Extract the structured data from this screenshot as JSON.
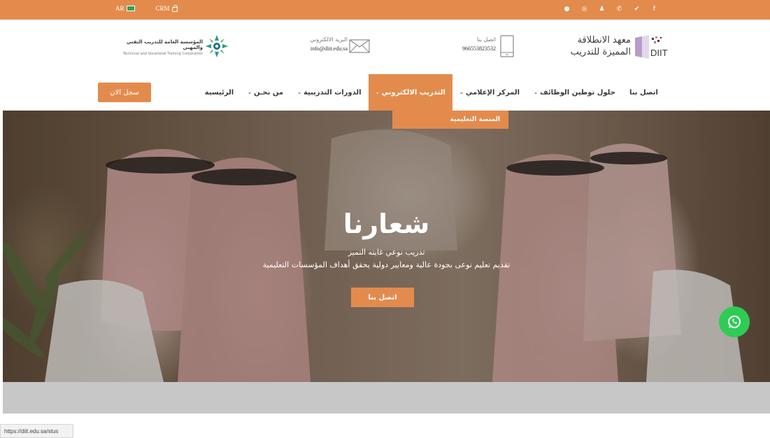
{
  "topbar": {
    "lang_label": "AR",
    "crm_label": "CRM",
    "social": [
      {
        "icon": "circle-icon",
        "glyph": "●"
      },
      {
        "icon": "instagram-icon",
        "glyph": "◎"
      },
      {
        "icon": "snapchat-icon",
        "glyph": "♟"
      },
      {
        "icon": "whatsapp-icon",
        "glyph": "✆"
      },
      {
        "icon": "twitter-icon",
        "glyph": "✔"
      },
      {
        "icon": "facebook-icon",
        "glyph": "f"
      }
    ]
  },
  "header": {
    "tvtc_ar": "المؤسسة العامة للتدريب التقني والمهني",
    "tvtc_en": "Technical and Vocational Training Corporation",
    "email_label": "البريد الالكتروني",
    "email_value": "info@diit.edu.sa",
    "phone_label": "اتصل بنا",
    "phone_value": "966553823532",
    "brand_line1": "معهد الانطلاقة",
    "brand_line2": "المميزة للتدريب",
    "brand_logo_text": "DIIT"
  },
  "nav": {
    "items": [
      {
        "label": "الرئيسية",
        "caret": ""
      },
      {
        "label": "من نحـن",
        "caret": "⌄"
      },
      {
        "label": "الدورات التدريبية",
        "caret": "⌄"
      },
      {
        "label": "التدريب الالكتروني",
        "caret": "⌄"
      },
      {
        "label": "المركز الإعلامي",
        "caret": "⌄"
      },
      {
        "label": "حلول توطين الوظائف",
        "caret": "⌄"
      },
      {
        "label": "اتصل بنا",
        "caret": ""
      }
    ],
    "register_label": "سجل الان",
    "dropdown_item": "المنصة التعليمية"
  },
  "hero": {
    "title": "شعارنا",
    "subtitle1": "تدريب نوعي غايته التميز",
    "subtitle2": "تقديم تعليم نوعى بجودة عالية ومعايير دولية يحقق أهداف المؤسسات التعليمية",
    "cta_label": "اتصل بنا"
  },
  "statusbar": {
    "url": "https://diit.edu.sa/stus"
  },
  "colors": {
    "accent": "#e38b4d",
    "whatsapp": "#2ecc55"
  }
}
